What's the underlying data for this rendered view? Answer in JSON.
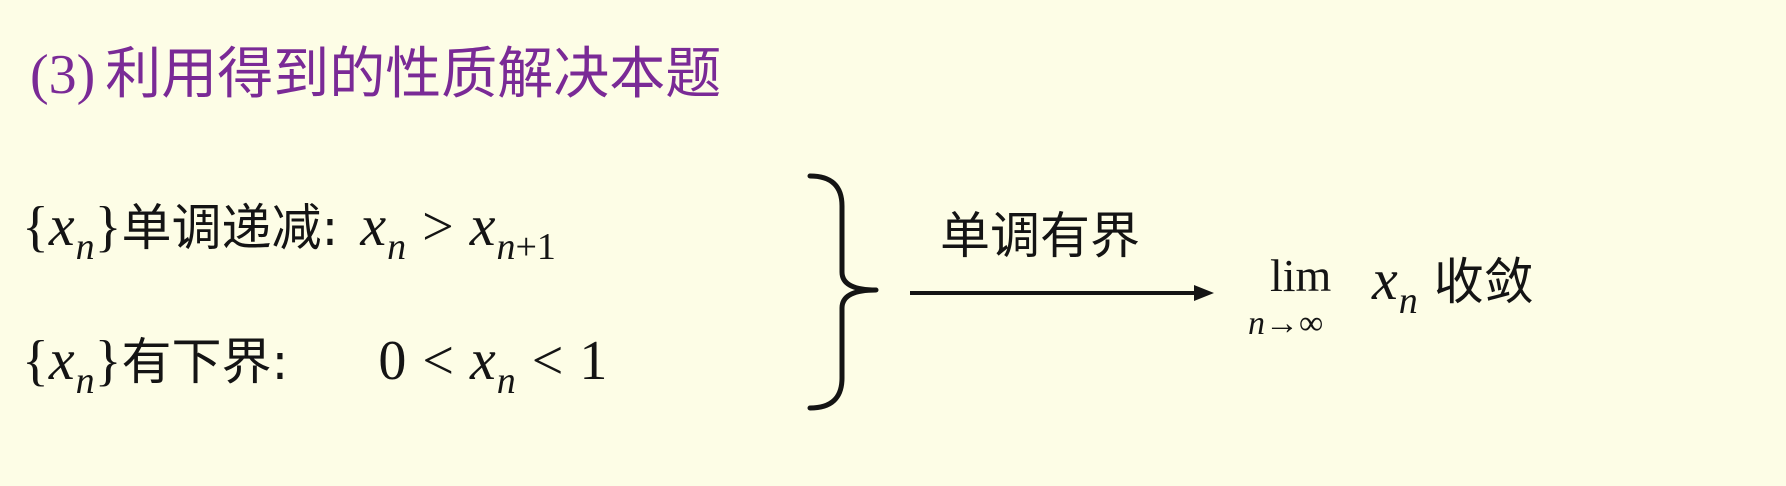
{
  "heading": {
    "number": "(3)",
    "text": "利用得到的性质解决本题"
  },
  "line1": {
    "set_open": "{",
    "var": "x",
    "sub": "n",
    "set_close": "}",
    "label": "单调递减",
    "colon": ":",
    "lhs_var": "x",
    "lhs_sub": "n",
    "op": ">",
    "rhs_var": "x",
    "rhs_sub_var": "n",
    "rhs_sub_rest": "+1"
  },
  "line2": {
    "set_open": "{",
    "var": "x",
    "sub": "n",
    "set_close": "}",
    "label": "有下界",
    "colon": ":",
    "left_num": "0",
    "op1": "<",
    "mid_var": "x",
    "mid_sub": "n",
    "op2": "<",
    "right_num": "1"
  },
  "arrow": {
    "label": "单调有界"
  },
  "conclusion": {
    "lim": "lim",
    "lim_sub_var": "n",
    "lim_sub_arrow": "→",
    "lim_sub_inf": "∞",
    "var": "x",
    "sub": "n",
    "text": "收敛"
  },
  "colors": {
    "background": "#fdfde6",
    "heading": "#7a2a96",
    "text": "#141414"
  }
}
